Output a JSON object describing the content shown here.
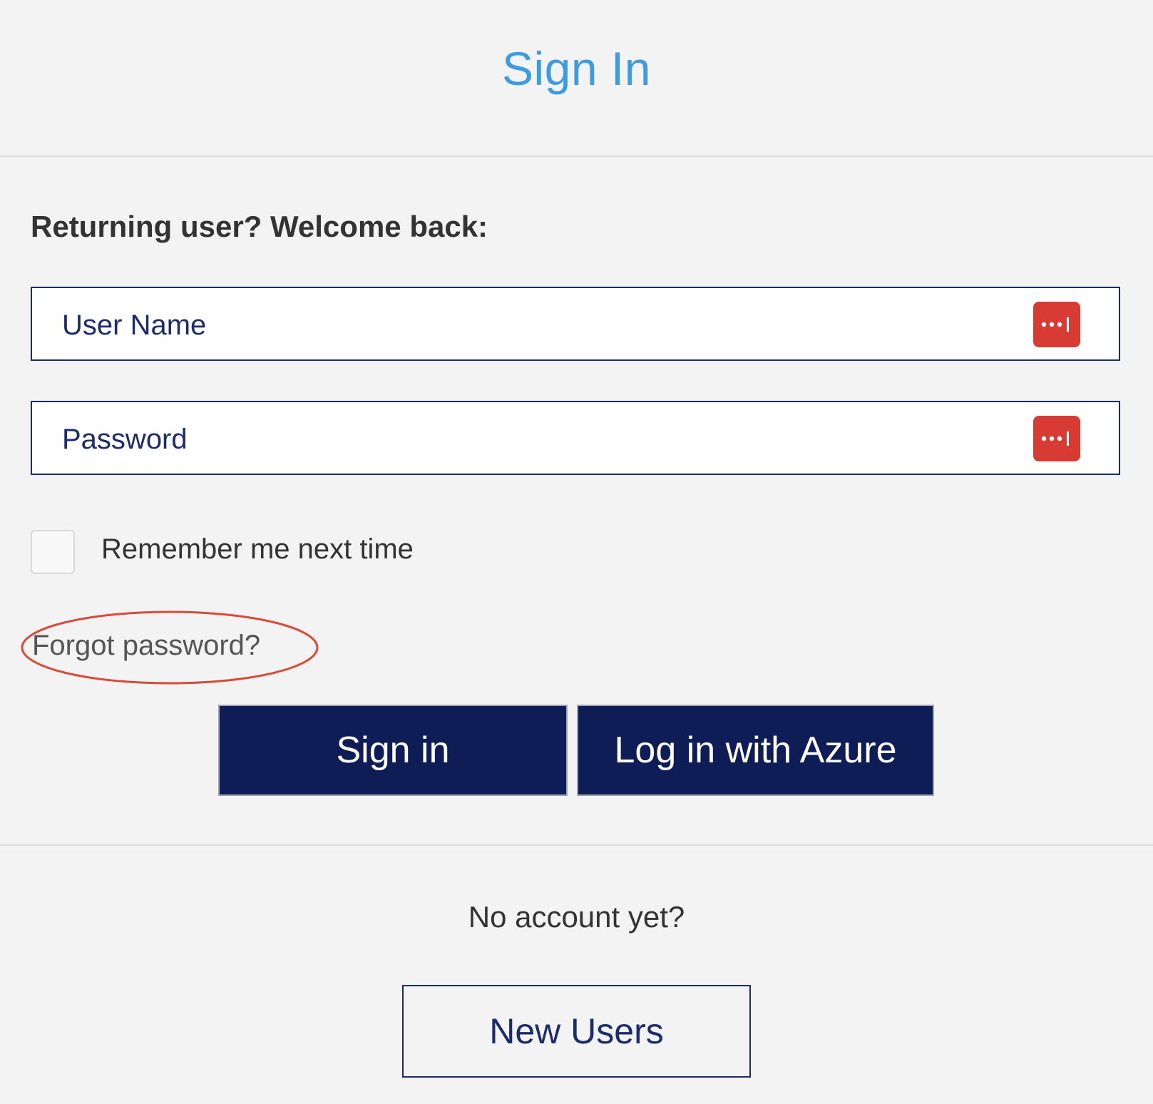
{
  "header": {
    "title": "Sign In"
  },
  "login": {
    "prompt": "Returning user? Welcome back:",
    "username_placeholder": "User Name",
    "password_placeholder": "Password",
    "password_manager_icon": "password-manager-icon",
    "remember_label": "Remember me next time",
    "remember_checked": false,
    "forgot_label": "Forgot password?",
    "signin_label": "Sign in",
    "azure_label": "Log in with Azure"
  },
  "signup": {
    "prompt": "No account yet?",
    "new_users_label": "New Users"
  },
  "colors": {
    "title": "#3d9be0",
    "primary_button": "#0e1d55",
    "field_border": "#1c2b6b",
    "password_icon": "#d83a34",
    "annotation_ellipse": "#d84a3a"
  }
}
